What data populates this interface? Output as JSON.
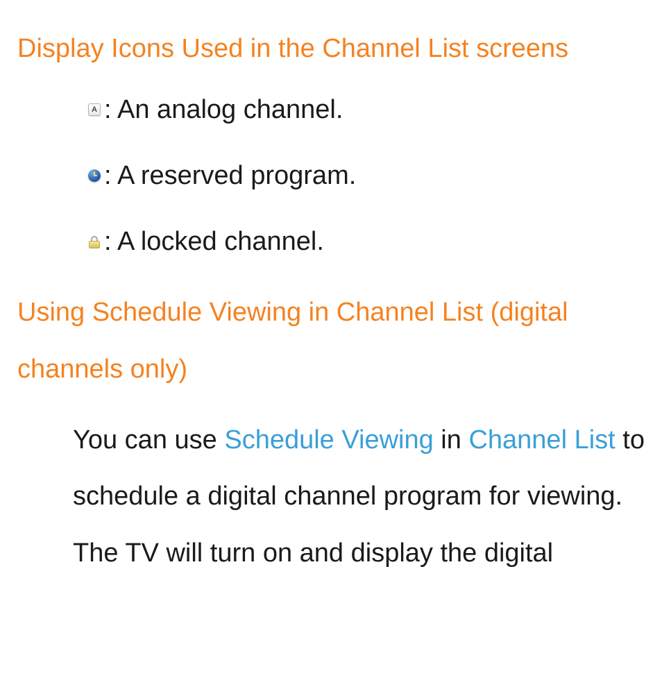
{
  "section1": {
    "heading": "Display Icons Used in the Channel List screens",
    "items": [
      {
        "icon": "analog-icon",
        "letter": "A",
        "text": ": An analog channel."
      },
      {
        "icon": "clock-icon",
        "letter": "",
        "text": ": A reserved program."
      },
      {
        "icon": "lock-icon",
        "letter": "",
        "text": ": A locked channel."
      }
    ]
  },
  "section2": {
    "heading": "Using Schedule Viewing in Channel List (digital channels only)",
    "body": {
      "t1": "You can use ",
      "link1": "Schedule Viewing",
      "t2": " in ",
      "link2": "Channel List",
      "t3": " to schedule a digital channel program for viewing. The TV will turn on and display the digital"
    }
  }
}
